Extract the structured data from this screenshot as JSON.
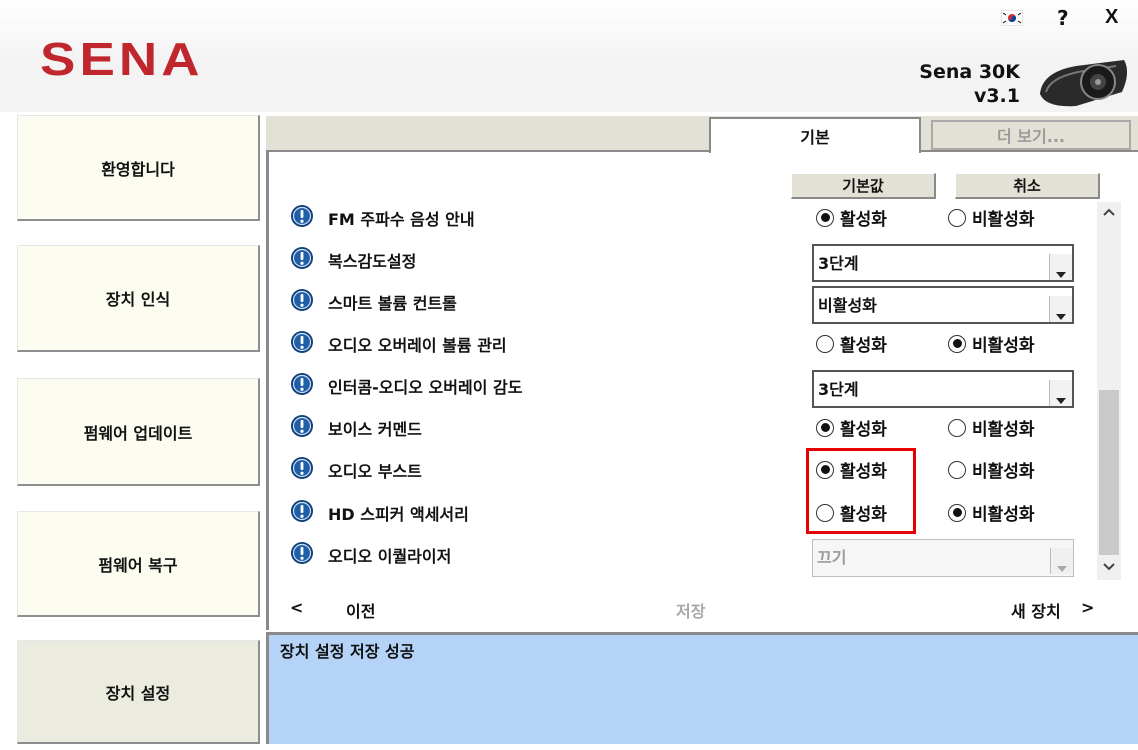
{
  "titlebar": {
    "help_label": "?",
    "close_label": "X",
    "flag_icon": "korean-flag-icon"
  },
  "brand": {
    "logo_text": "SENA",
    "logo_color": "#c0272d"
  },
  "device": {
    "model": "Sena 30K",
    "version": "v3.1"
  },
  "sidebar": {
    "items": [
      {
        "label": "환영합니다",
        "active": false
      },
      {
        "label": "장치 인식",
        "active": false
      },
      {
        "label": "펌웨어 업데이트",
        "active": false
      },
      {
        "label": "펌웨어 복구",
        "active": false
      },
      {
        "label": "장치 설정",
        "active": true
      }
    ]
  },
  "tabs": [
    {
      "label": "기본",
      "active": true
    },
    {
      "label": "더 보기...",
      "active": false
    }
  ],
  "actions": {
    "default_label": "기본값",
    "cancel_label": "취소"
  },
  "settings": [
    {
      "label": "FM 주파수 음성 안내",
      "type": "radio",
      "options": [
        "활성화",
        "비활성화"
      ],
      "selected": "활성화"
    },
    {
      "label": "복스감도설정",
      "type": "select",
      "value": "3단계"
    },
    {
      "label": "스마트 볼륨 컨트롤",
      "type": "select",
      "value": "비활성화"
    },
    {
      "label": "오디오 오버레이 볼륨 관리",
      "type": "radio",
      "options": [
        "활성화",
        "비활성화"
      ],
      "selected": "비활성화"
    },
    {
      "label": "인터콤-오디오 오버레이 감도",
      "type": "select",
      "value": "3단계"
    },
    {
      "label": "보이스 커멘드",
      "type": "radio",
      "options": [
        "활성화",
        "비활성화"
      ],
      "selected": "활성화"
    },
    {
      "label": "오디오 부스트",
      "type": "radio",
      "options": [
        "활성화",
        "비활성화"
      ],
      "selected": "활성화"
    },
    {
      "label": "HD 스피커 액세서리",
      "type": "radio",
      "options": [
        "활성화",
        "비활성화"
      ],
      "selected": "비활성화"
    },
    {
      "label": "오디오 이퀄라이저",
      "type": "select",
      "value": "끄기",
      "disabled": true
    }
  ],
  "nav": {
    "prev_arrow": "<",
    "prev_label": "이전",
    "save_label": "저장",
    "next_label": "새 장치",
    "next_arrow": ">"
  },
  "status": {
    "message": "장치 설정 저장 성공"
  },
  "colors": {
    "info_icon": "#1f5fa8",
    "status_bg": "#b5d3f7",
    "highlight": "#e60000"
  }
}
